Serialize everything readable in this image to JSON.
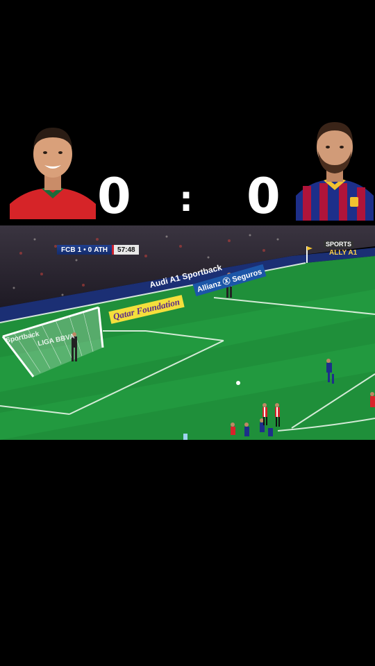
{
  "score": {
    "left": "0",
    "separator": ":",
    "right": "0"
  },
  "players": {
    "left": {
      "icon": "player-portrait-red-kit"
    },
    "right": {
      "icon": "player-portrait-blaugrana-kit"
    }
  },
  "scorebug": {
    "home": "FCB",
    "home_goals": "1",
    "divider": "•",
    "away_goals": "0",
    "away": "ATH",
    "clock": "57:48"
  },
  "ads": {
    "audi": "Audi A1 Sportback",
    "allianz": "Allianz Ⓧ Seguros",
    "qatar": "Qatar Foundation",
    "sportback": "Sportback",
    "laliga": "LIGA BBVA",
    "sports_tr": "SPORTS",
    "ally": "ALLY A1"
  },
  "colors": {
    "pitch": "#1f8f3a",
    "pitch_stripe": "#24a043",
    "crowd": "#2a2530",
    "home_kit": "#1d2f8a",
    "away_kit": "#d8232a",
    "ball": "#ffffff"
  }
}
